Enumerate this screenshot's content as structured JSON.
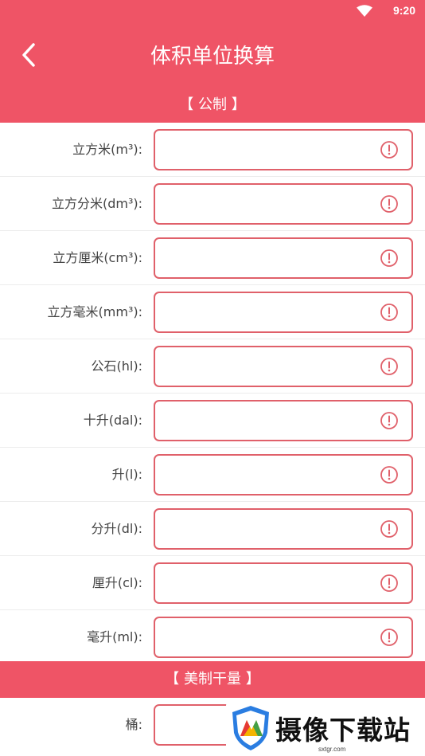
{
  "status_bar": {
    "time": "9:20"
  },
  "header": {
    "title": "体积单位换算"
  },
  "sections": [
    {
      "title": "【 公制 】",
      "rows": [
        {
          "label": "立方米(m³):",
          "value": ""
        },
        {
          "label": "立方分米(dm³):",
          "value": ""
        },
        {
          "label": "立方厘米(cm³):",
          "value": ""
        },
        {
          "label": "立方毫米(mm³):",
          "value": ""
        },
        {
          "label": "公石(hl):",
          "value": ""
        },
        {
          "label": "十升(dal):",
          "value": ""
        },
        {
          "label": "升(l):",
          "value": ""
        },
        {
          "label": "分升(dl):",
          "value": ""
        },
        {
          "label": "厘升(cl):",
          "value": ""
        },
        {
          "label": "毫升(ml):",
          "value": ""
        }
      ]
    },
    {
      "title": "【 美制干量 】",
      "rows": [
        {
          "label": "桶:",
          "value": ""
        }
      ]
    }
  ],
  "watermark": {
    "text": "摄像下载站",
    "url": "sxtgr.com"
  },
  "colors": {
    "accent": "#ef5466",
    "input_border": "#e0606a"
  }
}
